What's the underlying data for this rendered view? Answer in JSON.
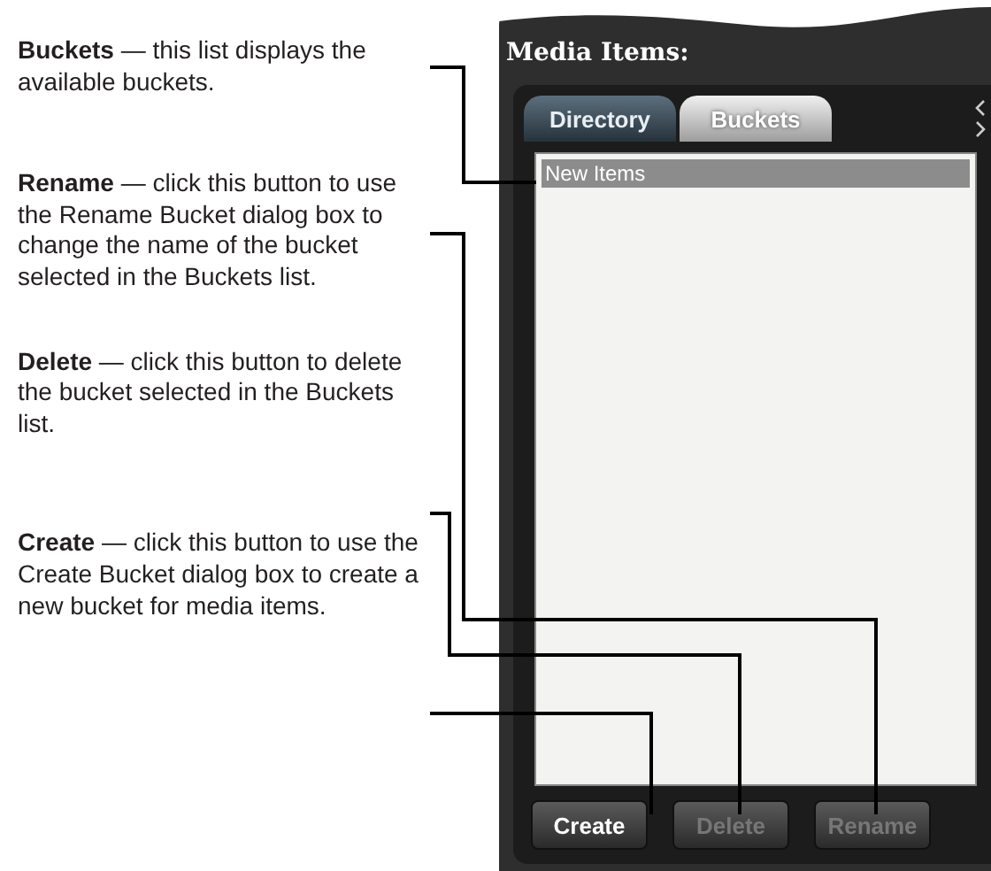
{
  "callouts": [
    {
      "text": "**Buckets** — this list displays the available buckets."
    },
    {
      "text": "**Rename** — click this button to use the Rename Bucket dialog box to change the name of the bucket selected in the Buckets list."
    },
    {
      "text": "**Delete** — click this button to delete the bucket selected in the Buckets list."
    },
    {
      "text": "**Create** — click this button to use the Create Bucket dialog box to create a new bucket for media items."
    }
  ],
  "panel": {
    "title": "Media Items:",
    "tabs": [
      {
        "label": "Directory",
        "selected": false
      },
      {
        "label": "Buckets",
        "selected": true
      }
    ],
    "bucket_list": [
      {
        "label": "New Items",
        "selected": true
      }
    ],
    "buttons": [
      {
        "label": "Create",
        "disabled": false
      },
      {
        "label": "Delete",
        "disabled": true
      },
      {
        "label": "Rename",
        "disabled": true
      }
    ]
  }
}
